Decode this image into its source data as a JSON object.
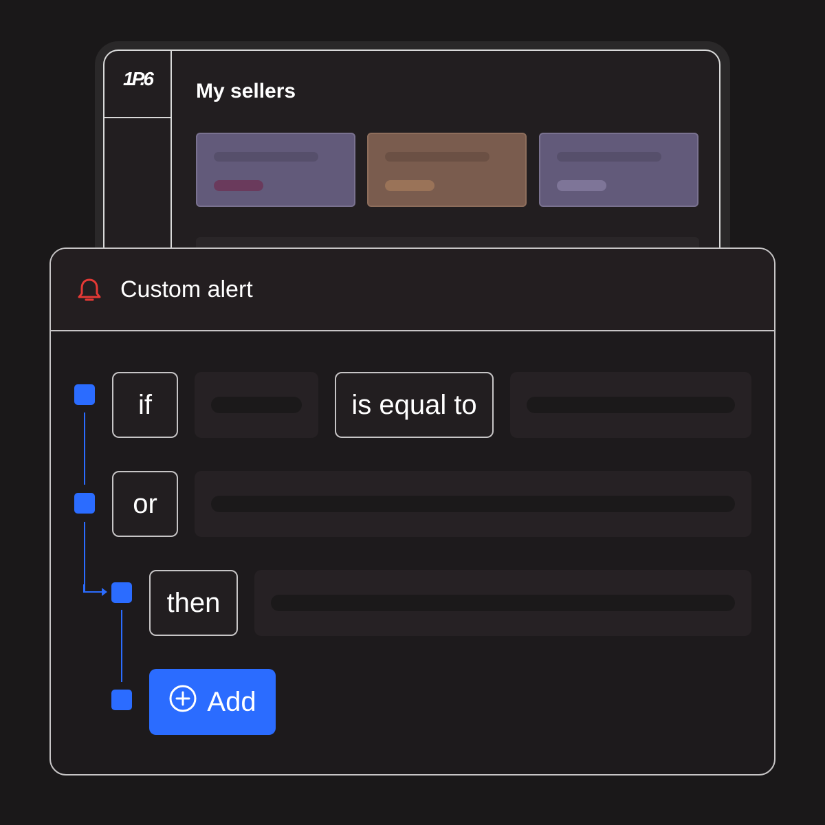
{
  "app": {
    "logo": "1P.6",
    "title": "My sellers",
    "cards": [
      {
        "bg": "#625a7a",
        "border": "#7a7290",
        "pill": "#6a3a5c"
      },
      {
        "bg": "#7a5c4e",
        "border": "#8e6e5c",
        "pill": "#9a7358"
      },
      {
        "bg": "#625a7a",
        "border": "#7a7290",
        "pill": "#7e7598"
      }
    ]
  },
  "panel": {
    "title": "Custom alert",
    "icon": "bell-icon",
    "icon_color": "#e53935",
    "rules": {
      "if_label": "if",
      "operator_label": "is equal to",
      "or_label": "or",
      "then_label": "then"
    },
    "add_label": "Add",
    "add_icon": "plus-circle-icon"
  },
  "colors": {
    "accent": "#2b6cff",
    "background": "#1a1819",
    "border": "#c7c5c6"
  }
}
